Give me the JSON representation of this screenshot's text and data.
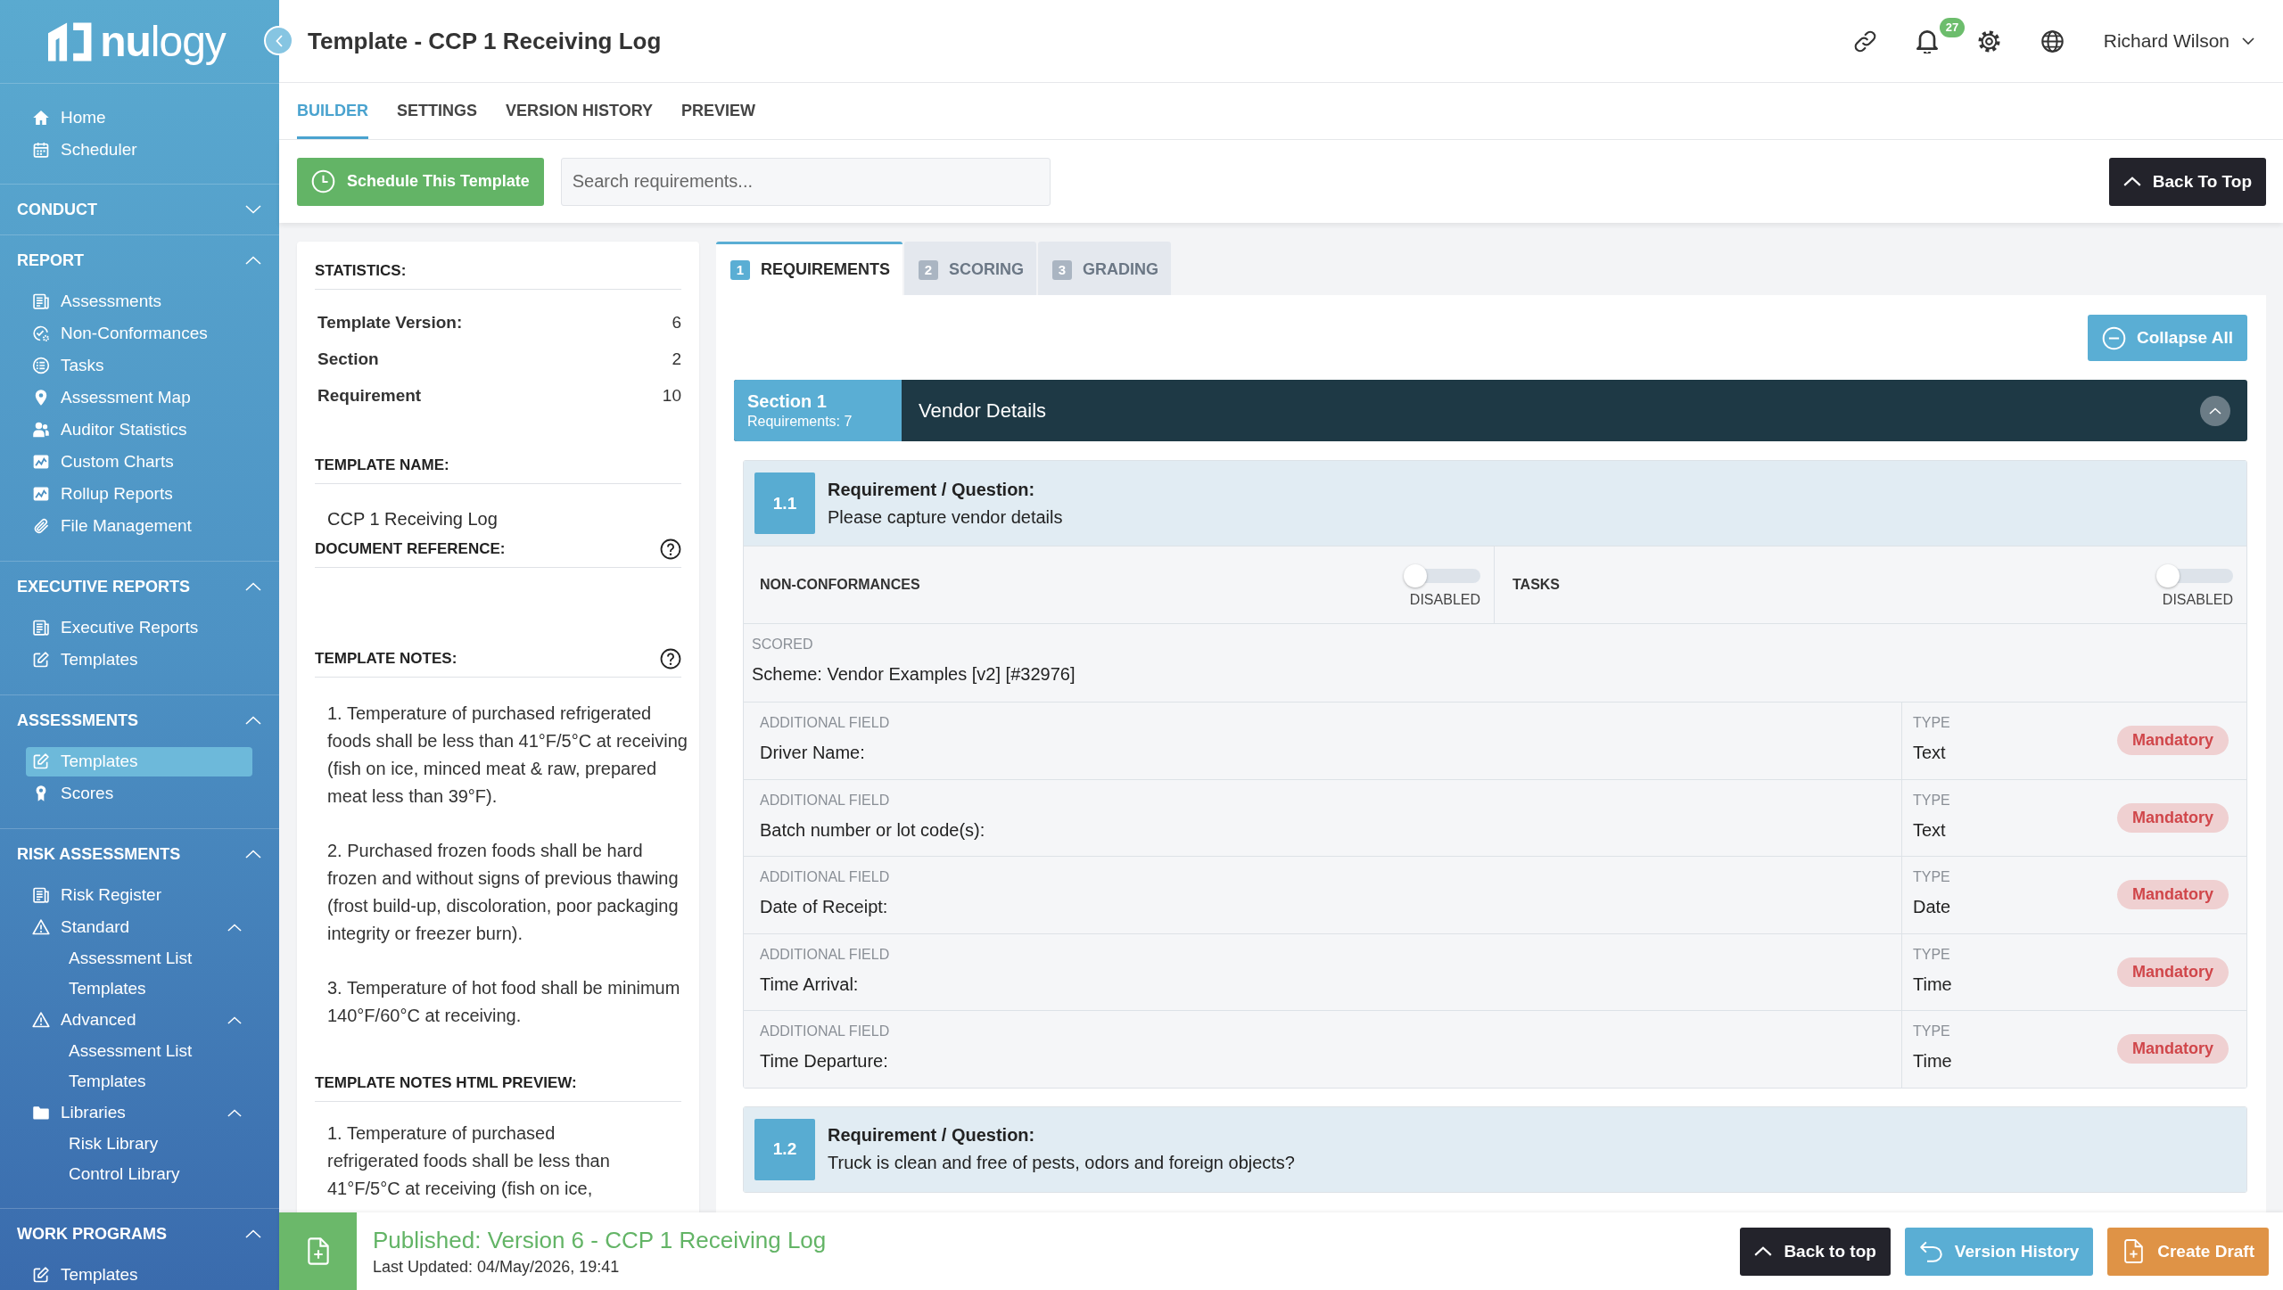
{
  "sidebar": {
    "logo_text": "**nu**logy",
    "top_items": [
      {
        "label": "Home",
        "selected": false
      },
      {
        "label": "Scheduler",
        "selected": false
      }
    ],
    "groups": [
      {
        "heading": "CONDUCT",
        "expanded": false
      },
      {
        "heading": "REPORT",
        "expanded": true,
        "items": [
          {
            "label": "Assessments",
            "selected": false
          },
          {
            "label": "Non-Conformances",
            "selected": false
          },
          {
            "label": "Tasks",
            "selected": false
          },
          {
            "label": "Assessment Map",
            "selected": false
          },
          {
            "label": "Auditor Statistics",
            "selected": false
          },
          {
            "label": "Custom Charts",
            "selected": false
          },
          {
            "label": "Rollup Reports",
            "selected": false
          },
          {
            "label": "File Management",
            "selected": false
          }
        ]
      },
      {
        "heading": "EXECUTIVE REPORTS",
        "expanded": true,
        "items": [
          {
            "label": "Executive Reports",
            "selected": false
          },
          {
            "label": "Templates",
            "selected": false
          }
        ]
      },
      {
        "heading": "ASSESSMENTS",
        "expanded": true,
        "items": [
          {
            "label": "Templates",
            "selected": true
          },
          {
            "label": "Scores",
            "selected": false
          }
        ]
      },
      {
        "heading": "RISK ASSESSMENTS",
        "expanded": true,
        "items": [
          {
            "label": "Risk Register",
            "selected": false
          },
          {
            "label": "Standard",
            "selected": false,
            "expanded": true,
            "children": [
              {
                "label": "Assessment List",
                "selected": false
              },
              {
                "label": "Templates",
                "selected": false
              }
            ]
          },
          {
            "label": "Advanced",
            "selected": false,
            "expanded": true,
            "children": [
              {
                "label": "Assessment List",
                "selected": false
              },
              {
                "label": "Templates",
                "selected": false
              }
            ]
          },
          {
            "label": "Libraries",
            "selected": false,
            "expanded": true,
            "children": [
              {
                "label": "Risk Library",
                "selected": false
              },
              {
                "label": "Control Library",
                "selected": false
              }
            ]
          }
        ]
      },
      {
        "heading": "WORK PROGRAMS",
        "expanded": true,
        "items": [
          {
            "label": "Templates",
            "selected": false
          }
        ]
      }
    ]
  },
  "header": {
    "title": "Template - CCP 1 Receiving Log",
    "notification_count": "27",
    "user_name": "Richard Wilson"
  },
  "tabs": [
    {
      "label": "BUILDER",
      "selected": true
    },
    {
      "label": "SETTINGS",
      "selected": false
    },
    {
      "label": "VERSION HISTORY",
      "selected": false
    },
    {
      "label": "PREVIEW",
      "selected": false
    }
  ],
  "toolbar": {
    "schedule_button": "Schedule This Template",
    "search": {
      "placeholder": "Search requirements..."
    },
    "back_to_top_button": "Back To Top"
  },
  "details_panel": {
    "statistics": {
      "heading": "STATISTICS:",
      "rows": [
        {
          "label": "Template Version:",
          "value": "6"
        },
        {
          "label": "Section",
          "value": "2"
        },
        {
          "label": "Requirement",
          "value": "10"
        }
      ]
    },
    "template_name": {
      "heading": "TEMPLATE NAME:",
      "value": "CCP 1 Receiving Log"
    },
    "document_reference": {
      "heading": "DOCUMENT REFERENCE:"
    },
    "template_notes": {
      "heading": "TEMPLATE NOTES:",
      "paragraphs": [
        "1. Temperature of purchased refrigerated foods shall be less than 41°F/5°C at receiving (fish on ice, minced meat & raw, prepared meat less than 39°F).",
        "2. Purchased frozen foods shall be hard frozen and without signs of previous thawing (frost build-up, discoloration, poor packaging integrity or freezer burn).",
        "3. Temperature of hot food shall be minimum 140°F/60°C at receiving."
      ]
    },
    "html_preview": {
      "heading": "TEMPLATE NOTES HTML PREVIEW:",
      "text": "1. Temperature of purchased refrigerated foods shall be less than 41°F/5°C at receiving (fish on ice,"
    }
  },
  "builder": {
    "tabs": [
      {
        "number": "1",
        "label": "REQUIREMENTS",
        "selected": true
      },
      {
        "number": "2",
        "label": "SCORING",
        "selected": false
      },
      {
        "number": "3",
        "label": "GRADING",
        "selected": false
      }
    ],
    "collapse_all_button": "Collapse All",
    "sections": [
      {
        "title": "Section 1",
        "requirements_count": "Requirements: 7",
        "name": "Vendor Details",
        "expanded": true,
        "requirements": [
          {
            "number": "1.1",
            "heading": "Requirement / Question:",
            "question": "Please capture vendor details",
            "toggles": [
              {
                "label": "NON-CONFORMANCES",
                "on": false,
                "status": "DISABLED"
              },
              {
                "label": "TASKS",
                "on": false,
                "status": "DISABLED"
              }
            ],
            "scoring": {
              "label": "SCORED",
              "scheme": "Scheme: Vendor Examples [v2] [#32976]"
            },
            "additional_fields": [
              {
                "label": "ADDITIONAL FIELD",
                "name": "Driver Name:",
                "type_label": "TYPE",
                "type": "Text",
                "badge": "Mandatory"
              },
              {
                "label": "ADDITIONAL FIELD",
                "name": "Batch number or lot code(s):",
                "type_label": "TYPE",
                "type": "Text",
                "badge": "Mandatory"
              },
              {
                "label": "ADDITIONAL FIELD",
                "name": "Date of Receipt:",
                "type_label": "TYPE",
                "type": "Date",
                "badge": "Mandatory"
              },
              {
                "label": "ADDITIONAL FIELD",
                "name": "Time Arrival:",
                "type_label": "TYPE",
                "type": "Time",
                "badge": "Mandatory"
              },
              {
                "label": "ADDITIONAL FIELD",
                "name": "Time Departure:",
                "type_label": "TYPE",
                "type": "Time",
                "badge": "Mandatory"
              }
            ]
          },
          {
            "number": "1.2",
            "heading": "Requirement / Question:",
            "question": "Truck is clean and free of pests, odors and foreign objects?"
          }
        ]
      }
    ]
  },
  "footer": {
    "status": "Published: Version 6 - CCP 1 Receiving Log",
    "last_updated": "Last Updated: 04/May/2026, 19:41",
    "buttons": [
      {
        "label": "Back to top",
        "kind": "top"
      },
      {
        "label": "Version History",
        "kind": "history"
      },
      {
        "label": "Create Draft",
        "kind": "draft"
      }
    ]
  }
}
